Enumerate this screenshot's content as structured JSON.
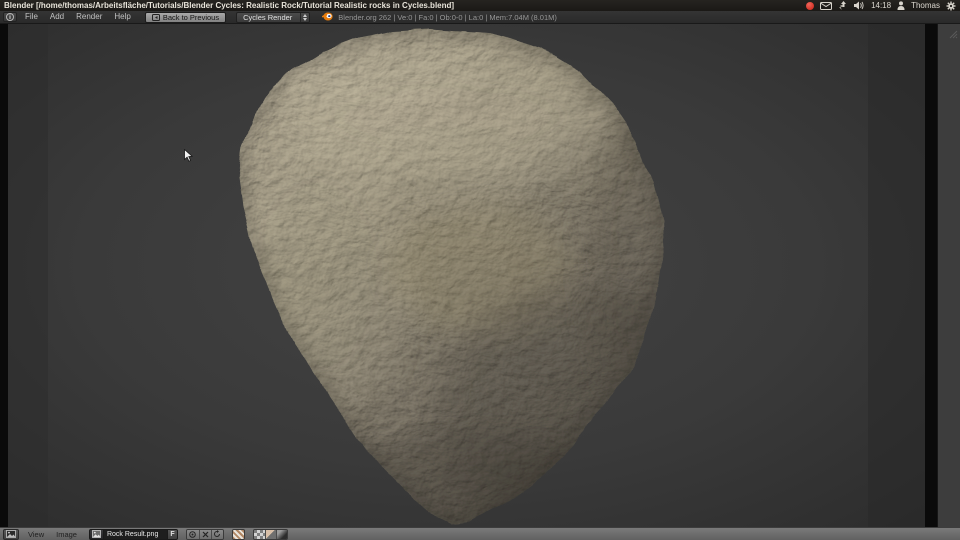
{
  "window": {
    "title": "Blender [/home/thomas/Arbeitsfläche/Tutorials/Blender Cycles: Realistic Rock/Tutorial Realistic rocks in Cycles.blend]"
  },
  "system_tray": {
    "time": "14:18",
    "user": "Thomas"
  },
  "info_header": {
    "menus": [
      "File",
      "Add",
      "Render",
      "Help"
    ],
    "back_button_label": "Back to Previous",
    "render_engine": "Cycles Render",
    "stats": "Blender.org 262 | Ve:0 | Fa:0 | Ob:0-0 | La:0 | Mem:7.04M (8.01M)"
  },
  "image_editor": {
    "menus": [
      "View",
      "Image"
    ],
    "image_name": "Rock Result.png",
    "fake_user_label": "F"
  },
  "colors": {
    "panel_bg": "#1e1c19",
    "header_bg": "#2d2d2d",
    "editor_bg": "#0a0a0a",
    "viewport_bg": "#3a3a3a",
    "bottom_header_bg": "#6b6b6b",
    "accent_orange": "#e87d0d",
    "record_red": "#c92a1c",
    "rock_light": "#b5ac93",
    "rock_dark": "#56514a"
  }
}
